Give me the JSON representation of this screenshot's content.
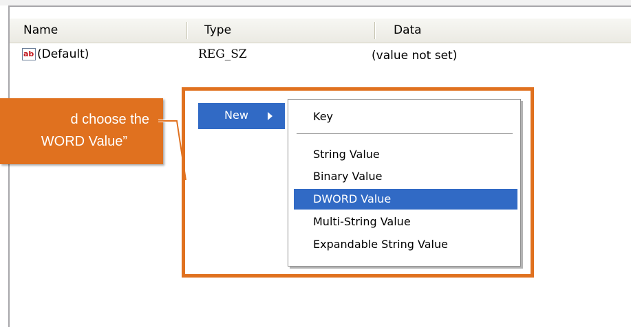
{
  "list_header": {
    "name": "Name",
    "type": "Type",
    "data": "Data"
  },
  "rows": [
    {
      "icon": "ab-string-icon",
      "icon_text": "ab",
      "name": "(Default)",
      "type": "REG_SZ",
      "data": "(value not set)"
    }
  ],
  "callout": {
    "line1": "d choose the",
    "line2": "WORD Value”"
  },
  "context_menu": {
    "new_label": "New",
    "submenu": {
      "items": [
        "Key",
        "String Value",
        "Binary Value",
        "DWORD Value",
        "Multi-String Value",
        "Expandable String Value"
      ],
      "selected": "DWORD Value"
    }
  },
  "colors": {
    "accent_orange": "#e0711f",
    "selection_blue": "#316ac5"
  }
}
